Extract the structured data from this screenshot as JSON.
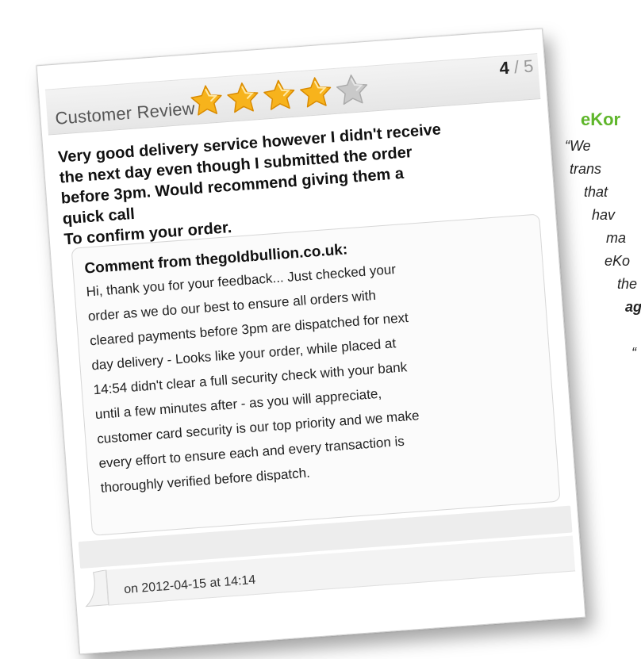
{
  "side_panel": {
    "title": "eKor",
    "lines": [
      {
        "text": "“We",
        "indent": 0,
        "bold": false
      },
      {
        "text": "trans",
        "indent": 6,
        "bold": false
      },
      {
        "text": "that",
        "indent": 24,
        "bold": false
      },
      {
        "text": "hav",
        "indent": 34,
        "bold": false
      },
      {
        "text": "ma",
        "indent": 52,
        "bold": false
      },
      {
        "text": "eKo",
        "indent": 50,
        "bold": false
      },
      {
        "text": "the",
        "indent": 66,
        "bold": false
      },
      {
        "text": "ag",
        "indent": 76,
        "bold": true
      },
      {
        "text": "",
        "indent": 0,
        "bold": false
      },
      {
        "text": "“",
        "indent": 84,
        "bold": false
      }
    ],
    "title_color": "#5fb62b"
  },
  "review": {
    "header_title": "Customer Review",
    "rating_score": "4",
    "rating_max": "/ 5",
    "rating_value": 4,
    "rating_out_of": 5,
    "star_color": "#f7b31c",
    "star_empty_color": "#c9c9c9",
    "body_lines": [
      "Very good delivery service however I didn't receive",
      "the next day even though I submitted the order",
      "before 3pm. Would recommend giving them a",
      "quick call",
      "To confirm your order."
    ],
    "comment": {
      "heading": "Comment from thegoldbullion.co.uk:",
      "lines": [
        "Hi, thank you for your feedback... Just checked your",
        "order as we do our best to ensure all orders with",
        "cleared payments before 3pm are dispatched for next",
        "day delivery - Looks like your order, while placed at",
        "14:54 didn't clear a full security check with your bank",
        "until a few minutes after - as you will appreciate,",
        "customer card security is our top priority and we make",
        "every effort to ensure each and every transaction is",
        "thoroughly verified before dispatch."
      ]
    },
    "meta": "on 2012-04-15 at 14:14"
  }
}
